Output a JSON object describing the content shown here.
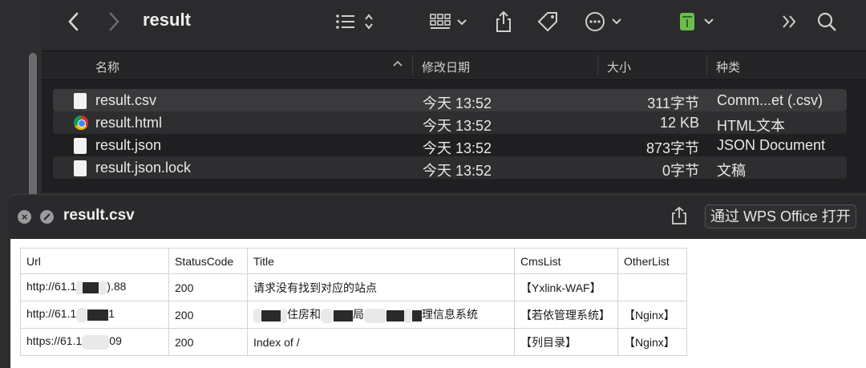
{
  "finder": {
    "title": "result",
    "toolbar_icons": [
      "back-chevron-icon",
      "forward-chevron-icon",
      "list-view-icon",
      "grid-view-icon",
      "share-icon",
      "tag-icon",
      "more-icon",
      "app-icon",
      "overflow-icon",
      "search-icon"
    ],
    "columns": {
      "name": "名称",
      "date": "修改日期",
      "size": "大小",
      "kind": "种类"
    },
    "files": [
      {
        "name": "result.csv",
        "date": "今天 13:52",
        "size": "311字节",
        "kind": "Comm...et (.csv)",
        "icon": "document-icon"
      },
      {
        "name": "result.html",
        "date": "今天 13:52",
        "size": "12 KB",
        "kind": "HTML文本",
        "icon": "chrome-icon"
      },
      {
        "name": "result.json",
        "date": "今天 13:52",
        "size": "873字节",
        "kind": "JSON Document",
        "icon": "document-icon"
      },
      {
        "name": "result.json.lock",
        "date": "今天 13:52",
        "size": "0字节",
        "kind": "文稿",
        "icon": "document-icon"
      }
    ]
  },
  "quicklook": {
    "title": "result.csv",
    "open_button": "通过 WPS Office 打开",
    "table": {
      "headers": [
        "Url",
        "StatusCode",
        "Title",
        "CmsList",
        "OtherList"
      ],
      "rows": [
        {
          "url_a": "http://61.1",
          "url_b": ").88",
          "status": "200",
          "title_a": "请求没有找到对应的站点",
          "title_b": "",
          "title_c": "",
          "title_d": "",
          "cms": "【Yxlink-WAF】",
          "other": ""
        },
        {
          "url_a": "http://61.1",
          "url_b": "1",
          "status": "200",
          "title_a": "",
          "title_b": "住房和",
          "title_c": "局",
          "title_d": "理信息系统",
          "cms": "【若依管理系统】",
          "other": "【Nginx】"
        },
        {
          "url_a": "https://61.1",
          "url_b": "09",
          "status": "200",
          "title_a": "Index of /",
          "title_b": "",
          "title_c": "",
          "title_d": "",
          "cms": "【列目录】",
          "other": "【Nginx】"
        }
      ]
    }
  }
}
